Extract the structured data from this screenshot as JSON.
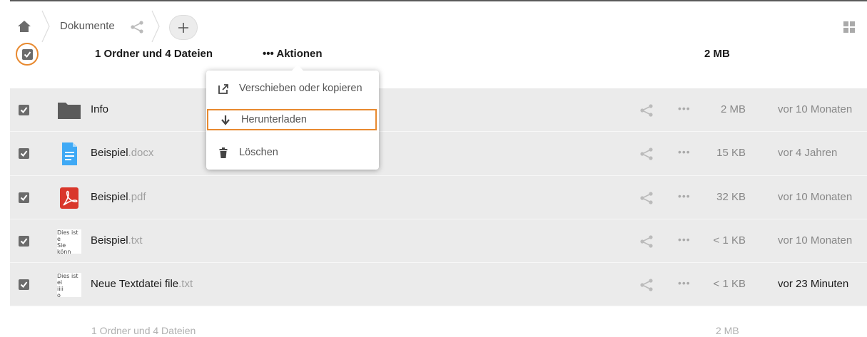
{
  "breadcrumb": {
    "current_folder": "Dokumente"
  },
  "header": {
    "summary": "1 Ordner und 4 Dateien",
    "actions_label": "••• Aktionen",
    "total_size": "2 MB"
  },
  "dropdown": {
    "items": [
      {
        "label": "Verschieben oder kopieren",
        "icon": "external-move-icon"
      },
      {
        "label": "Herunterladen",
        "icon": "download-arrow-icon"
      },
      {
        "label": "Löschen",
        "icon": "trash-icon"
      }
    ]
  },
  "files": [
    {
      "name": "Info",
      "ext": "",
      "type": "folder",
      "size": "2 MB",
      "date": "vor 10 Monaten"
    },
    {
      "name": "Beispiel",
      "ext": ".docx",
      "type": "docx",
      "size": "15 KB",
      "date": "vor 4 Jahren"
    },
    {
      "name": "Beispiel",
      "ext": ".pdf",
      "type": "pdf",
      "size": "32 KB",
      "date": "vor 10 Monaten"
    },
    {
      "name": "Beispiel",
      "ext": ".txt",
      "type": "txt",
      "size": "< 1 KB",
      "date": "vor 10 Monaten",
      "thumb": [
        "Dies ist e",
        "Sie könn"
      ]
    },
    {
      "name": "Neue Textdatei file",
      "ext": ".txt",
      "type": "txt",
      "size": "< 1 KB",
      "date": "vor 23 Minuten",
      "thumb": [
        "Dies ist ei",
        "iiii",
        "o"
      ]
    }
  ],
  "footer": {
    "summary": "1 Ordner und 4 Dateien",
    "total_size": "2 MB"
  },
  "colors": {
    "accent": "#e8892f",
    "row_bg": "#ebebeb",
    "folder": "#5b5b5b",
    "docx": "#3fa9f5",
    "pdf": "#d9372b"
  }
}
